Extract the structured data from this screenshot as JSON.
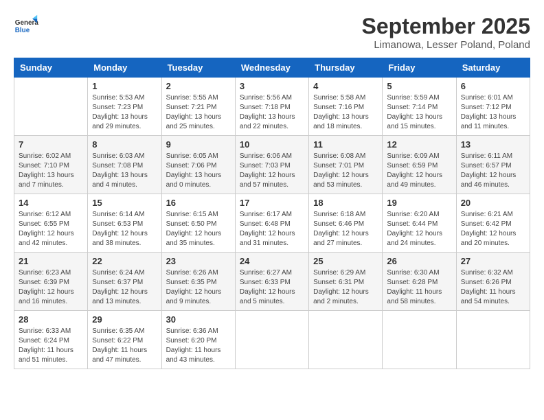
{
  "logo": {
    "general": "General",
    "blue": "Blue"
  },
  "title": "September 2025",
  "subtitle": "Limanowa, Lesser Poland, Poland",
  "days_of_week": [
    "Sunday",
    "Monday",
    "Tuesday",
    "Wednesday",
    "Thursday",
    "Friday",
    "Saturday"
  ],
  "weeks": [
    [
      {
        "day": "",
        "info": ""
      },
      {
        "day": "1",
        "info": "Sunrise: 5:53 AM\nSunset: 7:23 PM\nDaylight: 13 hours\nand 29 minutes."
      },
      {
        "day": "2",
        "info": "Sunrise: 5:55 AM\nSunset: 7:21 PM\nDaylight: 13 hours\nand 25 minutes."
      },
      {
        "day": "3",
        "info": "Sunrise: 5:56 AM\nSunset: 7:18 PM\nDaylight: 13 hours\nand 22 minutes."
      },
      {
        "day": "4",
        "info": "Sunrise: 5:58 AM\nSunset: 7:16 PM\nDaylight: 13 hours\nand 18 minutes."
      },
      {
        "day": "5",
        "info": "Sunrise: 5:59 AM\nSunset: 7:14 PM\nDaylight: 13 hours\nand 15 minutes."
      },
      {
        "day": "6",
        "info": "Sunrise: 6:01 AM\nSunset: 7:12 PM\nDaylight: 13 hours\nand 11 minutes."
      }
    ],
    [
      {
        "day": "7",
        "info": "Sunrise: 6:02 AM\nSunset: 7:10 PM\nDaylight: 13 hours\nand 7 minutes."
      },
      {
        "day": "8",
        "info": "Sunrise: 6:03 AM\nSunset: 7:08 PM\nDaylight: 13 hours\nand 4 minutes."
      },
      {
        "day": "9",
        "info": "Sunrise: 6:05 AM\nSunset: 7:06 PM\nDaylight: 13 hours\nand 0 minutes."
      },
      {
        "day": "10",
        "info": "Sunrise: 6:06 AM\nSunset: 7:03 PM\nDaylight: 12 hours\nand 57 minutes."
      },
      {
        "day": "11",
        "info": "Sunrise: 6:08 AM\nSunset: 7:01 PM\nDaylight: 12 hours\nand 53 minutes."
      },
      {
        "day": "12",
        "info": "Sunrise: 6:09 AM\nSunset: 6:59 PM\nDaylight: 12 hours\nand 49 minutes."
      },
      {
        "day": "13",
        "info": "Sunrise: 6:11 AM\nSunset: 6:57 PM\nDaylight: 12 hours\nand 46 minutes."
      }
    ],
    [
      {
        "day": "14",
        "info": "Sunrise: 6:12 AM\nSunset: 6:55 PM\nDaylight: 12 hours\nand 42 minutes."
      },
      {
        "day": "15",
        "info": "Sunrise: 6:14 AM\nSunset: 6:53 PM\nDaylight: 12 hours\nand 38 minutes."
      },
      {
        "day": "16",
        "info": "Sunrise: 6:15 AM\nSunset: 6:50 PM\nDaylight: 12 hours\nand 35 minutes."
      },
      {
        "day": "17",
        "info": "Sunrise: 6:17 AM\nSunset: 6:48 PM\nDaylight: 12 hours\nand 31 minutes."
      },
      {
        "day": "18",
        "info": "Sunrise: 6:18 AM\nSunset: 6:46 PM\nDaylight: 12 hours\nand 27 minutes."
      },
      {
        "day": "19",
        "info": "Sunrise: 6:20 AM\nSunset: 6:44 PM\nDaylight: 12 hours\nand 24 minutes."
      },
      {
        "day": "20",
        "info": "Sunrise: 6:21 AM\nSunset: 6:42 PM\nDaylight: 12 hours\nand 20 minutes."
      }
    ],
    [
      {
        "day": "21",
        "info": "Sunrise: 6:23 AM\nSunset: 6:39 PM\nDaylight: 12 hours\nand 16 minutes."
      },
      {
        "day": "22",
        "info": "Sunrise: 6:24 AM\nSunset: 6:37 PM\nDaylight: 12 hours\nand 13 minutes."
      },
      {
        "day": "23",
        "info": "Sunrise: 6:26 AM\nSunset: 6:35 PM\nDaylight: 12 hours\nand 9 minutes."
      },
      {
        "day": "24",
        "info": "Sunrise: 6:27 AM\nSunset: 6:33 PM\nDaylight: 12 hours\nand 5 minutes."
      },
      {
        "day": "25",
        "info": "Sunrise: 6:29 AM\nSunset: 6:31 PM\nDaylight: 12 hours\nand 2 minutes."
      },
      {
        "day": "26",
        "info": "Sunrise: 6:30 AM\nSunset: 6:28 PM\nDaylight: 11 hours\nand 58 minutes."
      },
      {
        "day": "27",
        "info": "Sunrise: 6:32 AM\nSunset: 6:26 PM\nDaylight: 11 hours\nand 54 minutes."
      }
    ],
    [
      {
        "day": "28",
        "info": "Sunrise: 6:33 AM\nSunset: 6:24 PM\nDaylight: 11 hours\nand 51 minutes."
      },
      {
        "day": "29",
        "info": "Sunrise: 6:35 AM\nSunset: 6:22 PM\nDaylight: 11 hours\nand 47 minutes."
      },
      {
        "day": "30",
        "info": "Sunrise: 6:36 AM\nSunset: 6:20 PM\nDaylight: 11 hours\nand 43 minutes."
      },
      {
        "day": "",
        "info": ""
      },
      {
        "day": "",
        "info": ""
      },
      {
        "day": "",
        "info": ""
      },
      {
        "day": "",
        "info": ""
      }
    ]
  ]
}
